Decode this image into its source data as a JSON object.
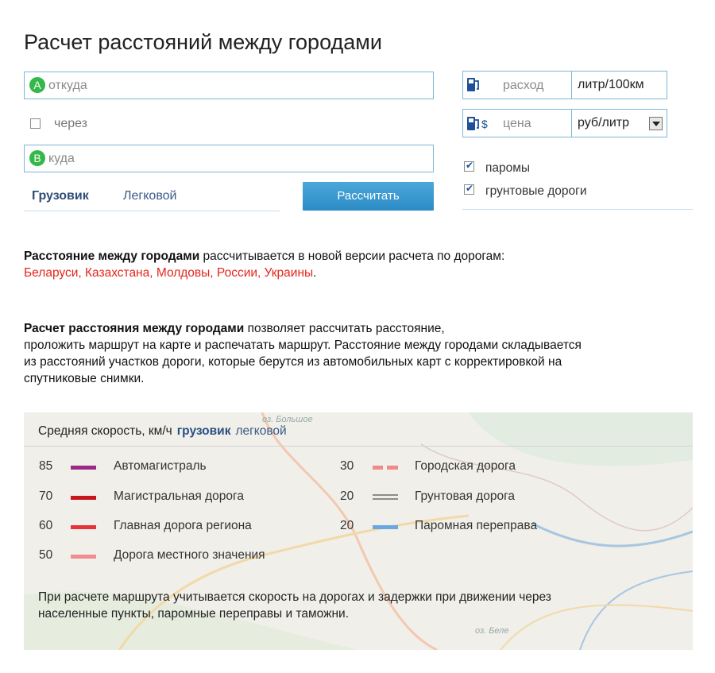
{
  "title": "Расчет расстояний между городами",
  "from": {
    "marker": "A",
    "placeholder": "откуда"
  },
  "via": {
    "label": "через",
    "checked": false
  },
  "to": {
    "marker": "B",
    "placeholder": "куда"
  },
  "tabs": [
    {
      "label": "Грузовик",
      "active": true
    },
    {
      "label": "Легковой",
      "active": false
    }
  ],
  "calc_button": "Рассчитать",
  "fuel": {
    "consumption_label": "расход",
    "consumption_unit": "литр/100км",
    "price_currency": "$",
    "price_label": "цена",
    "price_unit": "руб/литр"
  },
  "options": [
    {
      "label": "паромы",
      "checked": true
    },
    {
      "label": "грунтовые дороги",
      "checked": true
    }
  ],
  "info1": {
    "bold": "Расстояние между городами",
    "rest": " рассчитывается в новой версии расчета по дорогам:",
    "countries": "Беларуси, Казахстана, Молдовы, России, Украины",
    "period": "."
  },
  "info2": {
    "bold": "Расчет расстояния между городами",
    "rest1": " позволяет рассчитать расстояние,",
    "line2": "проложить маршрут на карте и распечатать маршрут. Расстояние между городами складывается",
    "line3": "из расстояний участков дороги, которые берутся из автомобильных карт с корректировкой на",
    "line4": "спутниковые снимки."
  },
  "speed_panel": {
    "title": "Средняя скорость, км/ч",
    "truck_link": "грузовик",
    "car_link": "легковой",
    "left_items": [
      {
        "speed": "85",
        "label": "Автомагистраль",
        "color": "#9b2a86"
      },
      {
        "speed": "70",
        "label": "Магистральная дорога",
        "color": "#c8151b"
      },
      {
        "speed": "60",
        "label": "Главная дорога региона",
        "color": "#e4363a"
      },
      {
        "speed": "50",
        "label": "Дорога местного значения",
        "color": "#ef8e8e"
      }
    ],
    "right_items": [
      {
        "speed": "30",
        "label": "Городская дорога",
        "color": "#f08a8a",
        "dashed": true
      },
      {
        "speed": "20",
        "label": "Грунтовая дорога",
        "color": "#8c8c8c",
        "double": true
      },
      {
        "speed": "20",
        "label": "Паромная переправа",
        "color": "#6aa8e0"
      }
    ],
    "note_line1": "При расчете маршрута учитывается скорость на дорогах и задержки при движении через",
    "note_line2": "населенные пункты, паромные переправы и таможни.",
    "map_labels": [
      "оз. Большое",
      "оз. Беле"
    ]
  }
}
